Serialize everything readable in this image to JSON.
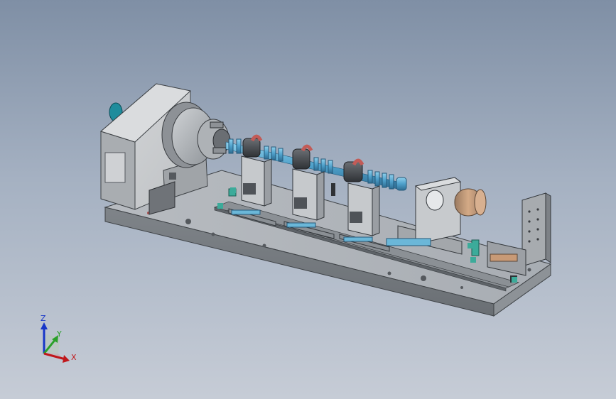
{
  "viewport": {
    "background_top": "#7f8fa5",
    "background_bottom": "#c6ccd6"
  },
  "triad": {
    "x_label": "X",
    "y_label": "Y",
    "z_label": "Z",
    "x_color": "#c0171b",
    "y_color": "#2aa02a",
    "z_color": "#1736c8"
  },
  "model": {
    "accent_blue": "#5aa6cf",
    "accent_red": "#c25b57",
    "accent_copper": "#c89a76",
    "steel": "#9ea4ab",
    "dark_steel": "#5d6166"
  }
}
